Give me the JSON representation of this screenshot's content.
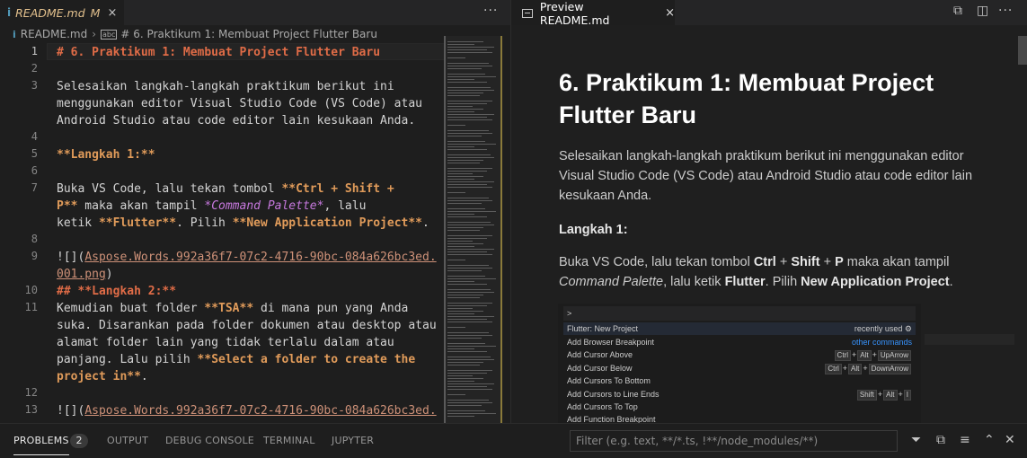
{
  "left_tab": {
    "icon": "i",
    "name": "README.md",
    "modified": "M",
    "close": "×"
  },
  "more": "···",
  "breadcrumb": {
    "icon": "i",
    "file": "README.md",
    "sep": "›",
    "symbol_icon": "abc",
    "section": "# 6. Praktikum 1: Membuat Project Flutter Baru"
  },
  "editor": {
    "line_numbers": [
      "1",
      "2",
      "3",
      "",
      "",
      "4",
      "5",
      "6",
      "7",
      "",
      "",
      "8",
      "9",
      "",
      "10",
      "11",
      "",
      "",
      "",
      "",
      "12",
      "13"
    ],
    "lines": {
      "l1": "# 6. Praktikum 1: Membuat Project Flutter Baru",
      "l3a": "Selesaikan langkah-langkah praktikum berikut ini",
      "l3b": "menggunakan editor Visual Studio Code (VS Code) atau",
      "l3c": "Android Studio atau code editor lain kesukaan Anda.",
      "l5": "**Langkah 1:**",
      "l7a_1": "Buka VS Code, lalu tekan tombol ",
      "l7a_2": "**Ctrl + Shift +",
      "l7b_1": "P**",
      "l7b_2": " maka akan tampil ",
      "l7b_3": "*Command Palette*",
      "l7b_4": ", lalu",
      "l7c_1": "ketik ",
      "l7c_2": "**Flutter**",
      "l7c_3": ". Pilih ",
      "l7c_4": "**New Application Project**",
      "l7c_5": ".",
      "l9a_1": "![](",
      "l9a_2": "Aspose.Words.992a36f7-07c2-4716-90bc-084a626bc3ed.",
      "l9b_1": "001.png",
      "l9b_2": ")",
      "l10": "## **Langkah 2:**",
      "l11a_1": "Kemudian buat folder ",
      "l11a_2": "**TSA**",
      "l11a_3": " di mana pun yang Anda",
      "l11b": "suka. Disarankan pada folder dokumen atau desktop atau",
      "l11c": "alamat folder lain yang tidak terlalu dalam atau",
      "l11d_1": "panjang. Lalu pilih ",
      "l11d_2": "**Select a folder to create the",
      "l11e": "project in**",
      "l11e_2": ".",
      "l13_1": "![](",
      "l13_2": "Aspose.Words.992a36f7-07c2-4716-90bc-084a626bc3ed."
    }
  },
  "preview_tab": {
    "name": "Preview README.md",
    "close": "×"
  },
  "preview": {
    "h1": "6. Praktikum 1: Membuat Project Flutter Baru",
    "p1": "Selesaikan langkah-langkah praktikum berikut ini menggunakan editor Visual Studio Code (VS Code) atau Android Studio atau code editor lain kesukaan Anda.",
    "langkah1": "Langkah 1:",
    "p2_a": "Buka VS Code, lalu tekan tombol ",
    "p2_ctrl": "Ctrl",
    "p2_plus1": " + ",
    "p2_shift": "Shift",
    "p2_plus2": " + ",
    "p2_p": "P",
    "p2_b": " maka akan tampil ",
    "p2_cp": "Command Palette",
    "p2_c": ", lalu ketik ",
    "p2_flutter": "Flutter",
    "p2_d": ". Pilih ",
    "p2_nap": "New Application Project",
    "p2_e": "."
  },
  "palette": {
    "input": ">",
    "rows": [
      {
        "label": "Flutter: New Project",
        "right": "recently used"
      },
      {
        "label": "Add Browser Breakpoint",
        "right": "other commands"
      },
      {
        "label": "Add Cursor Above",
        "keys": [
          "Ctrl",
          "Alt",
          "UpArrow"
        ]
      },
      {
        "label": "Add Cursor Below",
        "keys": [
          "Ctrl",
          "Alt",
          "DownArrow"
        ]
      },
      {
        "label": "Add Cursors To Bottom"
      },
      {
        "label": "Add Cursors to Line Ends",
        "keys": [
          "Shift",
          "Alt",
          "I"
        ]
      },
      {
        "label": "Add Cursors To Top"
      },
      {
        "label": "Add Function Breakpoint"
      }
    ]
  },
  "panel": {
    "tabs": [
      "PROBLEMS",
      "OUTPUT",
      "DEBUG CONSOLE",
      "TERMINAL",
      "JUPYTER"
    ],
    "problems_count": "2",
    "filter_placeholder": "Filter (e.g. text, **/*.ts, !**/node_modules/**)"
  }
}
